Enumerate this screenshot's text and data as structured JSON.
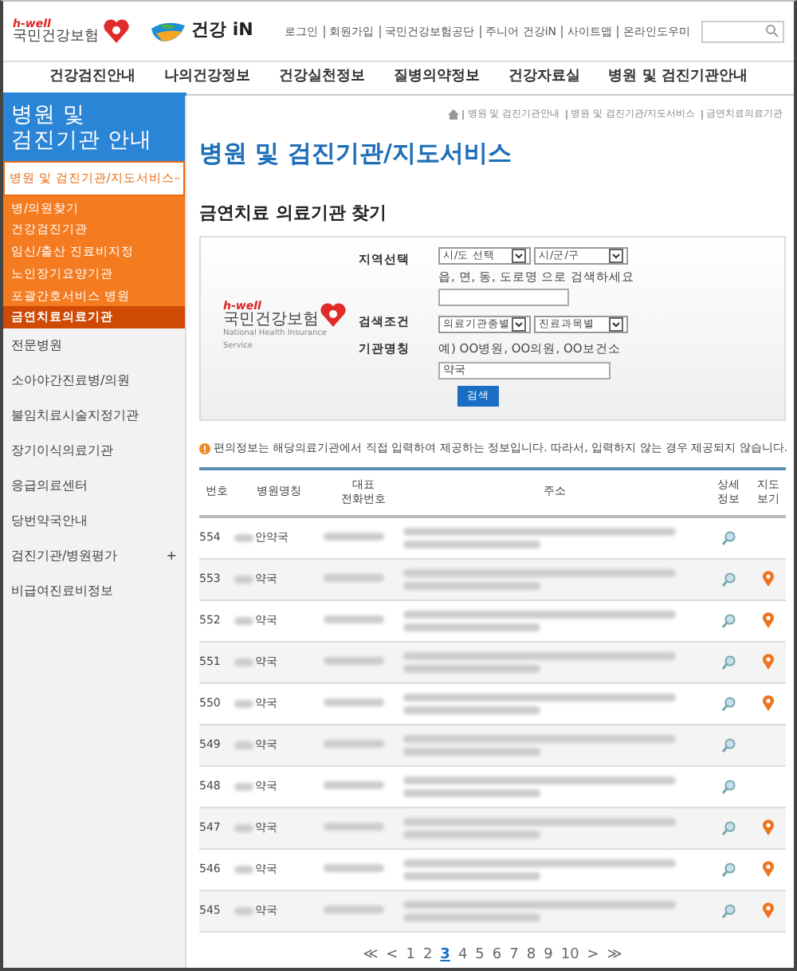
{
  "header": {
    "logo_small": "h-well",
    "logo_text": "국민건강보험",
    "brand": "건강 iN",
    "top_links": [
      "로그인",
      "회원가입",
      "국민건강보험공단",
      "주니어 건강iN",
      "사이트맵",
      "온라인도우미"
    ]
  },
  "nav": [
    "건강검진안내",
    "나의건강정보",
    "건강실천정보",
    "질병의약정보",
    "건강자료실",
    "병원 및 검진기관안내"
  ],
  "sidebar": {
    "title": "병원 및 검진기관 안내",
    "section": {
      "label": "병원 및 검진기관/지도서비스",
      "expanded": true,
      "toggle": "–"
    },
    "sub_items": [
      {
        "label": "병/의원찾기",
        "selected": false
      },
      {
        "label": "건강검진기관",
        "selected": false
      },
      {
        "label": "임신/출산 진료비지정",
        "selected": false
      },
      {
        "label": "노인장기요양기관",
        "selected": false
      },
      {
        "label": "포괄간호서비스 병원",
        "selected": false
      },
      {
        "label": "금연치료의료기관",
        "selected": true
      }
    ],
    "items": [
      {
        "label": "전문병원"
      },
      {
        "label": "소아야간진료병/의원"
      },
      {
        "label": "불임치료시술지정기관"
      },
      {
        "label": "장기이식의료기관"
      },
      {
        "label": "응급의료센터"
      },
      {
        "label": "당번약국안내"
      },
      {
        "label": "검진기관/병원평가",
        "toggle": "+"
      },
      {
        "label": "비급여진료비정보"
      }
    ]
  },
  "breadcrumb": [
    "병원 및 검진기관안내",
    "병원 및 검진기관/지도서비스",
    "금연치료의료기관"
  ],
  "page_title": "병원 및 검진기관/지도서비스",
  "section_title": "금연치료 의료기관 찾기",
  "form": {
    "logo_small": "h-well",
    "logo_text": "국민건강보험",
    "logo_sub": "National Health Insurance Service",
    "region_label": "지역선택",
    "region_selects": [
      "시/도 선택",
      "시/군/구"
    ],
    "region_hint": "읍, 면, 동, 도로명 으로 검색하세요",
    "condition_label": "검색조건",
    "condition_selects": [
      "의료기관종별",
      "진료과목별"
    ],
    "name_label": "기관명칭",
    "name_hint": "예) OO병원, OO의원, OO보건소",
    "name_value": "약국",
    "button": "검색"
  },
  "notice": "편의정보는 해당의료기관에서 직접 입력하여 제공하는 정보입니다. 따라서, 입력하지 않는 경우 제공되지 않습니다.",
  "table": {
    "columns": [
      "번호",
      "병원명칭",
      "대표\n전화번호",
      "주소",
      "상세\n정보",
      "지도\n보기"
    ],
    "rows": [
      {
        "number": "554",
        "name": "안약국",
        "map": false
      },
      {
        "number": "553",
        "name": "약국",
        "map": true
      },
      {
        "number": "552",
        "name": "약국",
        "map": true
      },
      {
        "number": "551",
        "name": "약국",
        "map": true
      },
      {
        "number": "550",
        "name": "약국",
        "map": true
      },
      {
        "number": "549",
        "name": "약국",
        "map": false
      },
      {
        "number": "548",
        "name": "약국",
        "map": false
      },
      {
        "number": "547",
        "name": "약국",
        "map": true
      },
      {
        "number": "546",
        "name": "약국",
        "map": true
      },
      {
        "number": "545",
        "name": "약국",
        "map": true
      }
    ]
  },
  "pagination": [
    {
      "label": "≪",
      "selected": false
    },
    {
      "label": "<",
      "selected": false
    },
    {
      "label": "1",
      "selected": false
    },
    {
      "label": "2",
      "selected": false
    },
    {
      "label": "3",
      "selected": true
    },
    {
      "label": "4",
      "selected": false
    },
    {
      "label": "5",
      "selected": false
    },
    {
      "label": "6",
      "selected": false
    },
    {
      "label": "7",
      "selected": false
    },
    {
      "label": "8",
      "selected": false
    },
    {
      "label": "9",
      "selected": false
    },
    {
      "label": "10",
      "selected": false
    },
    {
      "label": ">",
      "selected": false
    },
    {
      "label": "≫",
      "selected": false
    }
  ]
}
